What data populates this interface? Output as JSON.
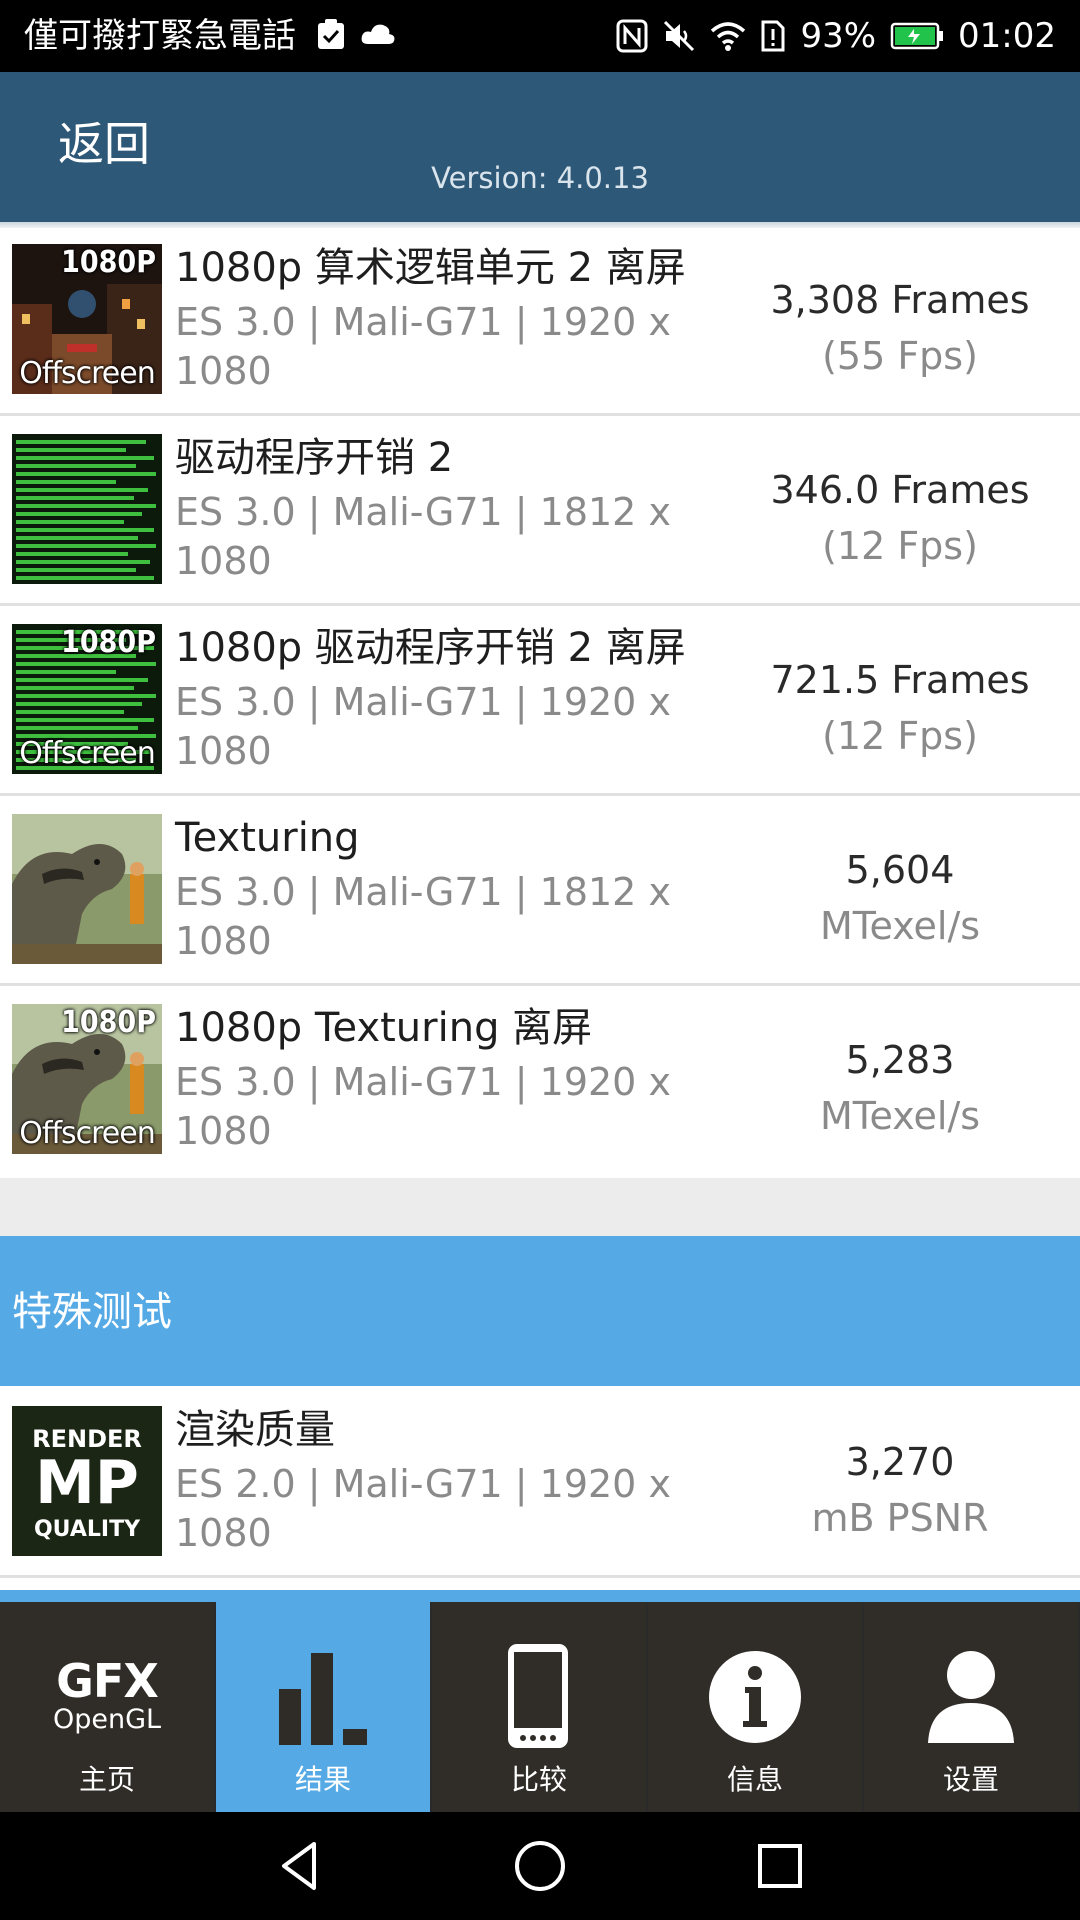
{
  "status_bar": {
    "carrier": "僅可撥打緊急電話",
    "battery": "93%",
    "time": "01:02"
  },
  "header": {
    "back_label": "返回",
    "version": "Version: 4.0.13"
  },
  "tests": [
    {
      "title": "1080p 算术逻辑单元 2 离屏",
      "subtitle": "ES 3.0 | Mali-G71 | 1920 x 1080",
      "score": "3,308 Frames",
      "unit": "(55 Fps)",
      "thumb_top": "1080P",
      "thumb_bottom": "Offscreen",
      "thumb_icon": "city-scene-icon"
    },
    {
      "title": "驱动程序开销 2",
      "subtitle": "ES 3.0 | Mali-G71 | 1812 x 1080",
      "score": "346.0 Frames",
      "unit": "(12 Fps)",
      "thumb_icon": "green-bars-icon"
    },
    {
      "title": "1080p 驱动程序开销 2 离屏",
      "subtitle": "ES 3.0 | Mali-G71 | 1920 x 1080",
      "score": "721.5 Frames",
      "unit": "(12 Fps)",
      "thumb_top": "1080P",
      "thumb_bottom": "Offscreen",
      "thumb_icon": "green-bars-icon"
    },
    {
      "title": "Texturing",
      "subtitle": "ES 3.0 | Mali-G71 | 1812 x 1080",
      "score": "5,604",
      "unit": "MTexel/s",
      "thumb_icon": "dinosaur-icon"
    },
    {
      "title": "1080p Texturing 离屏",
      "subtitle": "ES 3.0 | Mali-G71 | 1920 x 1080",
      "score": "5,283",
      "unit": "MTexel/s",
      "thumb_top": "1080P",
      "thumb_bottom": "Offscreen",
      "thumb_icon": "dinosaur-icon"
    }
  ],
  "special_section": {
    "title": "特殊测试",
    "item": {
      "title": "渲染质量",
      "subtitle": "ES 2.0 | Mali-G71 | 1920 x 1080",
      "score": "3,270",
      "unit": "mB PSNR",
      "thumb_line1": "RENDER",
      "thumb_line2": "MP",
      "thumb_line3": "QUALITY"
    }
  },
  "tabs": [
    {
      "label": "主页",
      "icon": "gfx-opengl-logo",
      "logo_line1": "GFX",
      "logo_line2": "OpenGL"
    },
    {
      "label": "结果",
      "icon": "bar-chart-icon",
      "active": true
    },
    {
      "label": "比较",
      "icon": "phone-icon"
    },
    {
      "label": "信息",
      "icon": "info-icon"
    },
    {
      "label": "设置",
      "icon": "user-icon"
    }
  ],
  "colors": {
    "header": "#2e5878",
    "accent": "#55aae6",
    "tab_bg": "#302c28"
  }
}
